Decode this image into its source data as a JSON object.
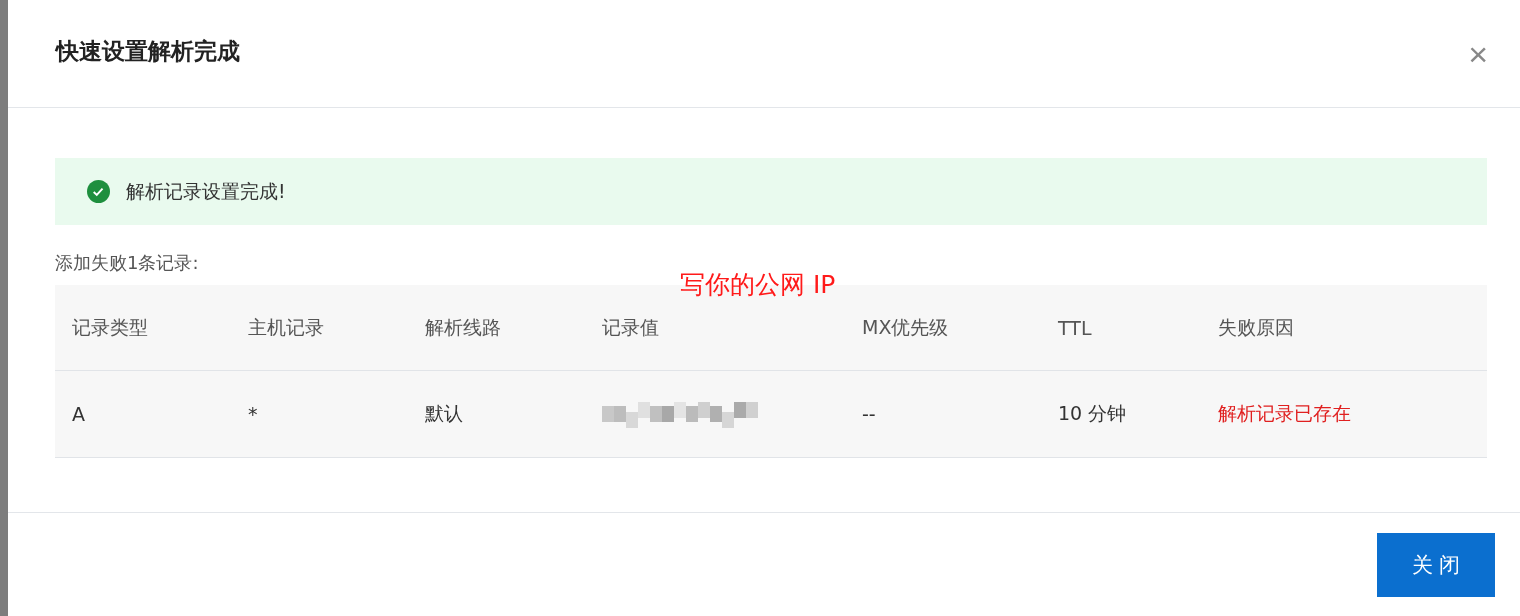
{
  "dialog": {
    "title": "快速设置解析完成",
    "close_label": "×"
  },
  "alert": {
    "kind": "success",
    "message": "解析记录设置完成!"
  },
  "failed_label": "添加失败1条记录:",
  "annotation": "写你的公网 IP",
  "table": {
    "columns": [
      "记录类型",
      "主机记录",
      "解析线路",
      "记录值",
      "MX优先级",
      "TTL",
      "失败原因"
    ],
    "rows": [
      {
        "cells": [
          {
            "kind": "text",
            "text": "A"
          },
          {
            "kind": "text",
            "text": "*"
          },
          {
            "kind": "text",
            "text": "默认"
          },
          {
            "kind": "redacted"
          },
          {
            "kind": "text",
            "text": "--"
          },
          {
            "kind": "text",
            "text": "10 分钟"
          },
          {
            "kind": "error",
            "text": "解析记录已存在"
          }
        ]
      }
    ]
  },
  "buttons": [
    {
      "label": "关 闭",
      "kind": "primary"
    }
  ]
}
